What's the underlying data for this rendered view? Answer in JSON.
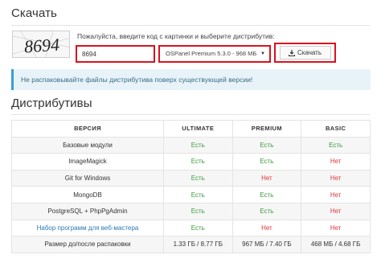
{
  "download": {
    "heading": "Скачать",
    "captcha_text": "8694",
    "prompt": "Пожалуйста, введите код с картинки и выберите дистрибутив:",
    "code_value": "8694",
    "distribution_selected": "OSPanel Premium 5.3.0 - 968 МБ",
    "download_label": "Скачать",
    "warning": "Не распаковывайте файлы дистрибутива поверх существующей версии!"
  },
  "distributions": {
    "heading": "Дистрибутивы",
    "columns": [
      "ВЕРСИЯ",
      "ULTIMATE",
      "PREMIUM",
      "BASIC"
    ],
    "rows": [
      {
        "feature": "Базовые модули",
        "ultimate": "Есть",
        "premium": "Есть",
        "basic": "Есть"
      },
      {
        "feature": "ImageMagick",
        "ultimate": "Есть",
        "premium": "Есть",
        "basic": "Нет"
      },
      {
        "feature": "Git for Windows",
        "ultimate": "Есть",
        "premium": "Нет",
        "basic": "Нет"
      },
      {
        "feature": "MongoDB",
        "ultimate": "Есть",
        "premium": "Есть",
        "basic": "Нет"
      },
      {
        "feature": "PostgreSQL + PhpPgAdmin",
        "ultimate": "Есть",
        "premium": "Есть",
        "basic": "Нет"
      },
      {
        "feature": "Набор программ для веб-мастера",
        "ultimate": "Есть",
        "premium": "Нет",
        "basic": "Нет"
      },
      {
        "feature": "Размер до/после распаковки",
        "ultimate": "1.33 ГБ / 8.77 ГБ",
        "premium": "967 МБ / 7.40 ГБ",
        "basic": "468 МБ / 4.68 ГБ"
      }
    ]
  },
  "colors": {
    "highlight_border": "#d9131c",
    "yes": "#3b9a3b",
    "no": "#e0343c",
    "link": "#2a7ab8",
    "alert_bg": "#e8f3f9"
  }
}
